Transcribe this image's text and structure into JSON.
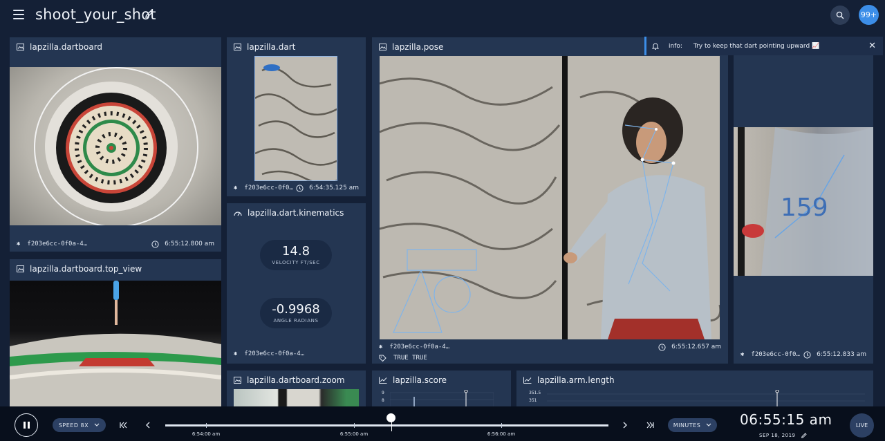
{
  "header": {
    "title": "shoot_your_shot",
    "notification_count": "99+"
  },
  "panels": {
    "dartboard": {
      "title": "lapzilla.dartboard",
      "stream_id": "f203e6cc-0f0a-4…",
      "timestamp": "6:55:12.800 am"
    },
    "dart": {
      "title": "lapzilla.dart",
      "stream_id": "f203e6cc-0f0…",
      "timestamp": "6:54:35.125 am"
    },
    "pose": {
      "title": "lapzilla.pose",
      "stream_id": "f203e6cc-0f0a-4…",
      "timestamp": "6:55:12.657 am",
      "tags": "TRUE  TRUE"
    },
    "right_cam": {
      "overlay_number": "159",
      "stream_id": "f203e6cc-0f0…",
      "timestamp": "6:55:12.833 am"
    },
    "top_view": {
      "title": "lapzilla.dartboard.top_view"
    },
    "kinematics": {
      "title": "lapzilla.dart.kinematics",
      "velocity_value": "14.8",
      "velocity_label": "VELOCITY FT/SEC",
      "angle_value": "-0.9968",
      "angle_label": "ANGLE RADIANS",
      "stream_id": "f203e6cc-0f0a-4…"
    },
    "zoom": {
      "title": "lapzilla.dartboard.zoom"
    },
    "score": {
      "title": "lapzilla.score",
      "tick_top": "9",
      "tick_second": "8"
    },
    "arm_length": {
      "title": "lapzilla.arm.length",
      "tick_top": "351.5",
      "tick_second": "351"
    }
  },
  "toast": {
    "label": "info:",
    "message": "Try to keep that dart pointing upward 📈"
  },
  "player": {
    "speed_label": "SPEED 8X",
    "timeline_labels": [
      "6:54:00 am",
      "6:55:00 am",
      "6:56:00 am"
    ],
    "progress": 0.51,
    "unit_label": "MINUTES",
    "clock": "06:55:15 am",
    "date": "SEP 18, 2019",
    "live_label": "LIVE"
  },
  "colors": {
    "background": "#142036",
    "panel": "#243652",
    "accent": "#3c8ee8"
  }
}
